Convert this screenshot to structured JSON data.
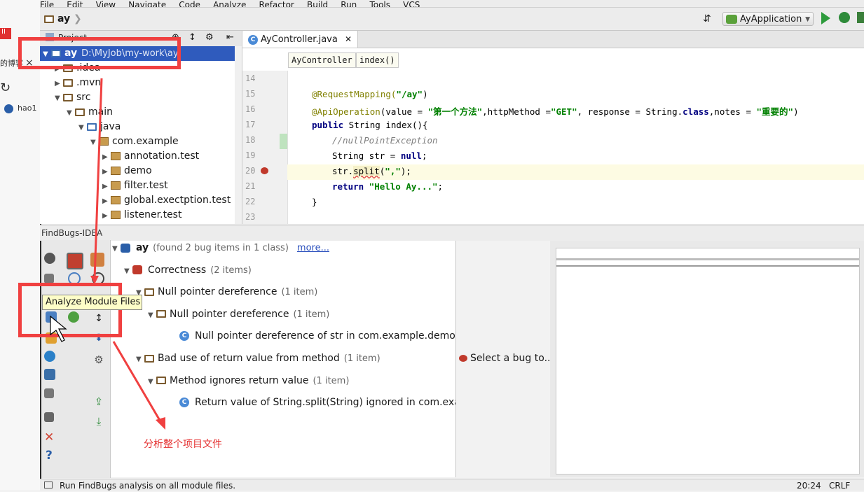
{
  "browser": {
    "tabs": [
      "II",
      "的博客",
      "hao1"
    ],
    "close_glyph": "×"
  },
  "menu": [
    "File",
    "Edit",
    "View",
    "Navigate",
    "Code",
    "Analyze",
    "Refactor",
    "Build",
    "Run",
    "Tools",
    "VCS"
  ],
  "navbar": {
    "project_crumb": "ay",
    "run_config": "AyApplication"
  },
  "project": {
    "header": "Project",
    "tree": [
      {
        "label": "ay",
        "path": "D:\\MyJob\\my-work\\ay",
        "depth": 0,
        "kind": "folder-blue",
        "expanded": true,
        "selected": true
      },
      {
        "label": ".idea",
        "depth": 1,
        "kind": "folder",
        "expanded": false
      },
      {
        "label": ".mvn",
        "depth": 1,
        "kind": "folder",
        "expanded": false
      },
      {
        "label": "src",
        "depth": 1,
        "kind": "folder",
        "expanded": true
      },
      {
        "label": "main",
        "depth": 2,
        "kind": "folder",
        "expanded": true
      },
      {
        "label": "java",
        "depth": 3,
        "kind": "folder-blue",
        "expanded": true
      },
      {
        "label": "com.example",
        "depth": 4,
        "kind": "package",
        "expanded": true
      },
      {
        "label": "annotation.test",
        "depth": 5,
        "kind": "package",
        "expanded": false
      },
      {
        "label": "demo",
        "depth": 5,
        "kind": "package",
        "expanded": false
      },
      {
        "label": "filter.test",
        "depth": 5,
        "kind": "package",
        "expanded": false
      },
      {
        "label": "global.exectption.test",
        "depth": 5,
        "kind": "package",
        "expanded": false
      },
      {
        "label": "listener.test",
        "depth": 5,
        "kind": "package",
        "expanded": false
      }
    ]
  },
  "editor": {
    "tab_label": "AyController.java",
    "breadcrumbs": [
      "AyController",
      "index()"
    ],
    "line_numbers": [
      "14",
      "15",
      "16",
      "17",
      "18",
      "19",
      "20",
      "21",
      "22",
      "23"
    ],
    "lines": {
      "l15_ann": "@RequestMapping(",
      "l15_str": "\"/ay\"",
      "l15_end": ")",
      "l16_ann": "@ApiOperation",
      "l16_a": "(value = ",
      "l16_s1": "\"第一个方法\"",
      "l16_b": ",httpMethod =",
      "l16_s2": "\"GET\"",
      "l16_c": ", response = String.",
      "l16_kw": "class",
      "l16_d": ",notes = ",
      "l16_s3": "\"重要的\"",
      "l16_e": ")",
      "l17_kw": "public",
      "l17_rest": " String index(){",
      "l18_cmt": "//nullPointException",
      "l19_a": "String str = ",
      "l19_kw": "null",
      "l19_b": ";",
      "l20_a": "str.",
      "l20_b": "split",
      "l20_c": "(",
      "l20_s": "\",\"",
      "l20_d": ");",
      "l21_kw": "return",
      "l21_s": " \"Hello Ay...\"",
      "l21_b": ";",
      "l22": "}"
    }
  },
  "findbugs": {
    "title": "FindBugs-IDEA",
    "tooltip": "Analyze Module Files",
    "tree": [
      {
        "label": "ay",
        "count": "(found 2 bug items in 1 class)",
        "link": "more...",
        "depth": 0,
        "icon": "bug-project"
      },
      {
        "label": "Correctness",
        "count": "(2 items)",
        "depth": 1,
        "icon": "bug-category"
      },
      {
        "label": "Null pointer dereference",
        "count": "(1 item)",
        "depth": 2,
        "icon": "folder"
      },
      {
        "label": "Null pointer dereference",
        "count": "(1 item)",
        "depth": 3,
        "icon": "folder"
      },
      {
        "label": "Null pointer dereference of str in com.example.demo.AyCon",
        "count": "",
        "depth": 4,
        "icon": "class"
      },
      {
        "label": "Bad use of return value from method",
        "count": "(1 item)",
        "depth": 2,
        "icon": "folder"
      },
      {
        "label": "Method ignores return value",
        "count": "(1 item)",
        "depth": 3,
        "icon": "folder"
      },
      {
        "label": "Return value of String.split(String) ignored in com.example.d",
        "count": "",
        "depth": 4,
        "icon": "class"
      }
    ],
    "details_placeholder": "Select a bug to..."
  },
  "annotation": {
    "text": "分析整个项目文件"
  },
  "status": {
    "message": "Run FindBugs analysis on all module files.",
    "position": "20:24",
    "line_sep": "CRLF"
  },
  "colors": {
    "annotation_red": "#f04040",
    "selection_blue": "#2f5bbd",
    "tooltip_yellow": "#fdfdc8"
  }
}
